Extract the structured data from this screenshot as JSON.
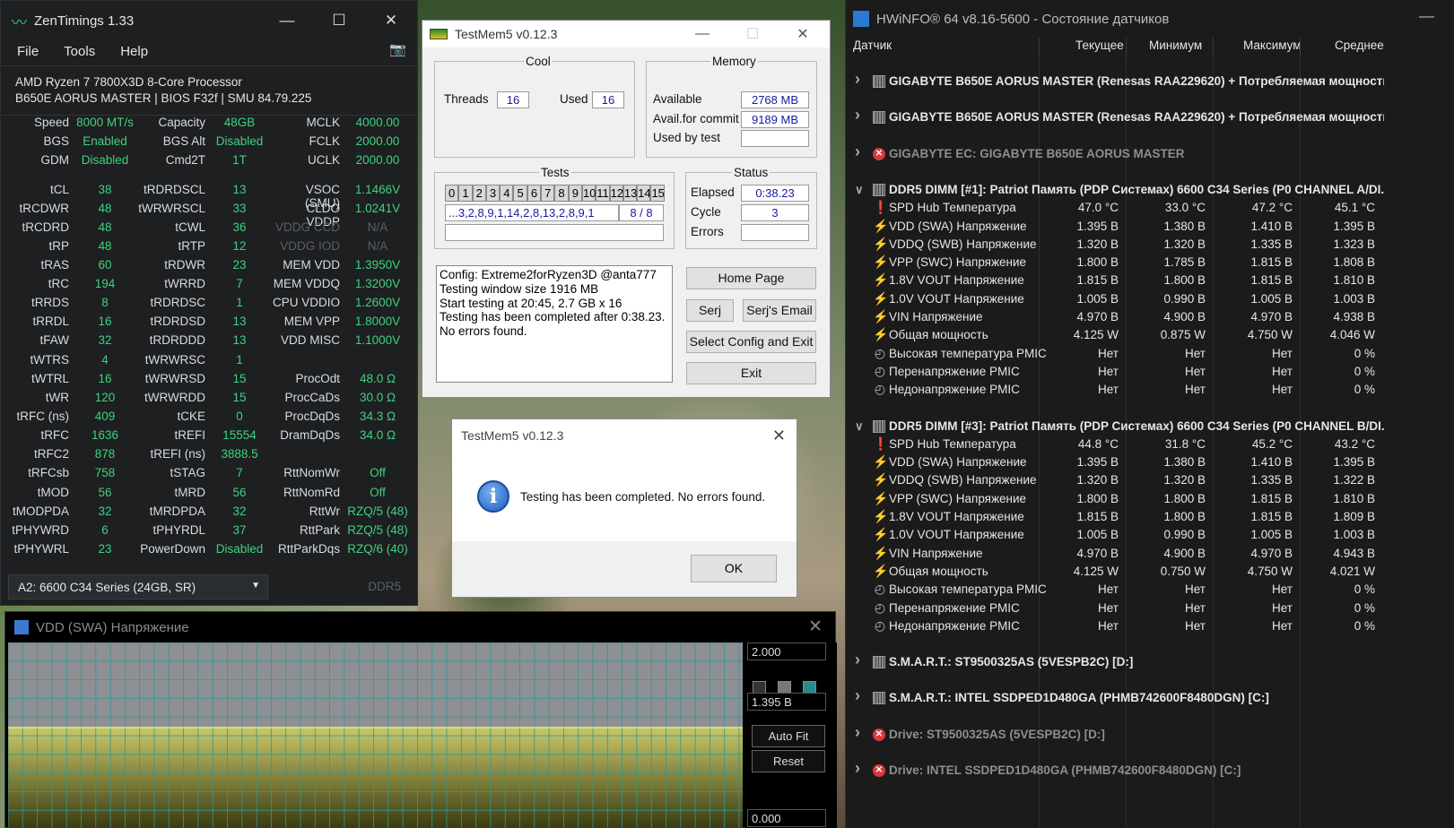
{
  "zentimings": {
    "title": "ZenTimings 1.33",
    "menu": [
      "File",
      "Tools",
      "Help"
    ],
    "cpu": "AMD Ryzen 7 7800X3D 8-Core Processor",
    "board": "B650E AORUS MASTER | BIOS F32f | SMU 84.79.225",
    "rows": [
      [
        "Speed",
        "8000 MT/s",
        "Capacity",
        "48GB",
        "MCLK",
        "4000.00"
      ],
      [
        "BGS",
        "Enabled",
        "BGS Alt",
        "Disabled",
        "FCLK",
        "2000.00"
      ],
      [
        "GDM",
        "Disabled",
        "Cmd2T",
        "1T",
        "UCLK",
        "2000.00"
      ],
      [
        "tCL",
        "38",
        "tRDRDSCL",
        "13",
        "VSOC (SMU)",
        "1.1466V"
      ],
      [
        "tRCDWR",
        "48",
        "tWRWRSCL",
        "33",
        "CLDO VDDP",
        "1.0241V"
      ],
      [
        "tRCDRD",
        "48",
        "tCWL",
        "36",
        "VDDG CCD",
        "N/A"
      ],
      [
        "tRP",
        "48",
        "tRTP",
        "12",
        "VDDG IOD",
        "N/A"
      ],
      [
        "tRAS",
        "60",
        "tRDWR",
        "23",
        "MEM VDD",
        "1.3950V"
      ],
      [
        "tRC",
        "194",
        "tWRRD",
        "7",
        "MEM VDDQ",
        "1.3200V"
      ],
      [
        "tRRDS",
        "8",
        "tRDRDSC",
        "1",
        "CPU VDDIO",
        "1.2600V"
      ],
      [
        "tRRDL",
        "16",
        "tRDRDSD",
        "13",
        "MEM VPP",
        "1.8000V"
      ],
      [
        "tFAW",
        "32",
        "tRDRDDD",
        "13",
        "VDD MISC",
        "1.1000V"
      ],
      [
        "tWTRS",
        "4",
        "tWRWRSC",
        "1",
        "",
        ""
      ],
      [
        "tWTRL",
        "16",
        "tWRWRSD",
        "15",
        "ProcOdt",
        "48.0 Ω"
      ],
      [
        "tWR",
        "120",
        "tWRWRDD",
        "15",
        "ProcCaDs",
        "30.0 Ω"
      ],
      [
        "tRFC (ns)",
        "409",
        "tCKE",
        "0",
        "ProcDqDs",
        "34.3 Ω"
      ],
      [
        "tRFC",
        "1636",
        "tREFI",
        "15554",
        "DramDqDs",
        "34.0 Ω"
      ],
      [
        "tRFC2",
        "878",
        "tREFI (ns)",
        "3888.5",
        "",
        ""
      ],
      [
        "tRFCsb",
        "758",
        "tSTAG",
        "7",
        "RttNomWr",
        "Off"
      ],
      [
        "tMOD",
        "56",
        "tMRD",
        "56",
        "RttNomRd",
        "Off"
      ],
      [
        "tMODPDA",
        "32",
        "tMRDPDA",
        "32",
        "RttWr",
        "RZQ/5 (48)"
      ],
      [
        "tPHYWRD",
        "6",
        "tPHYRDL",
        "37",
        "RttPark",
        "RZQ/5 (48)"
      ],
      [
        "tPHYWRL",
        "23",
        "PowerDown",
        "Disabled",
        "RttParkDqs",
        "RZQ/6 (40)"
      ]
    ],
    "module": "A2: 6600 C34 Series (24GB, SR)",
    "ddr": "DDR5"
  },
  "testmem": {
    "title": "TestMem5 v0.12.3",
    "cool": "Cool",
    "threads_label": "Threads",
    "threads": "16",
    "used_label": "Used",
    "used": "16",
    "memory": "Memory",
    "available_label": "Available",
    "available": "2768 MB",
    "commit_label": "Avail.for commit",
    "commit": "9189 MB",
    "usedby_label": "Used by test",
    "usedby": "",
    "tests": "Tests",
    "cells": [
      "0",
      "1",
      "2",
      "3",
      "4",
      "5",
      "6",
      "7",
      "8",
      "9",
      "10",
      "11",
      "12",
      "13",
      "14",
      "15"
    ],
    "sequence": "...3,2,8,9,1,14,2,8,13,2,8,9,1",
    "progress": "8 / 8",
    "status": "Status",
    "elapsed_label": "Elapsed",
    "elapsed": "0:38.23",
    "cycle_label": "Cycle",
    "cycle": "3",
    "errors_label": "Errors",
    "errors": "",
    "log": [
      "Config: Extreme2forRyzen3D @anta777",
      "Testing window size 1916 MB",
      "Start testing at 20:45, 2.7 GB x 16",
      "Testing has been completed after 0:38.23.",
      "No errors found."
    ],
    "home": "Home Page",
    "serj": "Serj",
    "email": "Serj's Email",
    "select": "Select Config and Exit",
    "exit": "Exit"
  },
  "dialog": {
    "title": "TestMem5 v0.12.3",
    "message": "Testing has been completed. No errors found.",
    "ok": "OK"
  },
  "graph": {
    "title": "VDD (SWA) Напряжение",
    "max": "2.000",
    "current": "1.395 В",
    "min": "0.000",
    "autofit": "Auto Fit",
    "reset": "Reset",
    "level": 0.6975
  },
  "hwinfo": {
    "title": "HWiNFO® 64 v8.16-5600 - Состояние датчиков",
    "headers": [
      "Датчик",
      "Текущее",
      "Минимум",
      "Максимум",
      "Среднее"
    ],
    "rows": [
      {
        "t": "g",
        "icon": "chip",
        "name": "GIGABYTE B650E AORUS MASTER (Renesas RAA229620) + Потребляемая мощность ...",
        "open": false
      },
      {
        "t": "b"
      },
      {
        "t": "g",
        "icon": "chip",
        "name": "GIGABYTE B650E AORUS MASTER (Renesas RAA229620) + Потребляемая мощность ...",
        "open": false
      },
      {
        "t": "b"
      },
      {
        "t": "g",
        "icon": "err",
        "name": "GIGABYTE EC: GIGABYTE B650E AORUS MASTER",
        "open": false
      },
      {
        "t": "b"
      },
      {
        "t": "g",
        "icon": "chip",
        "name": "DDR5 DIMM [#1]: Patriot Память (PDP Системах) 6600 C34 Series (P0 CHANNEL A/DI...",
        "open": true
      },
      {
        "t": "s",
        "icon": "temp",
        "name": "SPD Hub Температура",
        "v": [
          "47.0 °C",
          "33.0 °C",
          "47.2 °C",
          "45.1 °C"
        ]
      },
      {
        "t": "s",
        "icon": "volt",
        "name": "VDD (SWA) Напряжение",
        "v": [
          "1.395 В",
          "1.380 В",
          "1.410 В",
          "1.395 В"
        ]
      },
      {
        "t": "s",
        "icon": "volt",
        "name": "VDDQ (SWB) Напряжение",
        "v": [
          "1.320 В",
          "1.320 В",
          "1.335 В",
          "1.323 В"
        ]
      },
      {
        "t": "s",
        "icon": "volt",
        "name": "VPP (SWC) Напряжение",
        "v": [
          "1.800 В",
          "1.785 В",
          "1.815 В",
          "1.808 В"
        ]
      },
      {
        "t": "s",
        "icon": "volt",
        "name": "1.8V VOUT Напряжение",
        "v": [
          "1.815 В",
          "1.800 В",
          "1.815 В",
          "1.810 В"
        ]
      },
      {
        "t": "s",
        "icon": "volt",
        "name": "1.0V VOUT Напряжение",
        "v": [
          "1.005 В",
          "0.990 В",
          "1.005 В",
          "1.003 В"
        ]
      },
      {
        "t": "s",
        "icon": "volt",
        "name": "VIN Напряжение",
        "v": [
          "4.970 В",
          "4.900 В",
          "4.970 В",
          "4.938 В"
        ]
      },
      {
        "t": "s",
        "icon": "volt",
        "name": "Общая мощность",
        "v": [
          "4.125 W",
          "0.875 W",
          "4.750 W",
          "4.046 W"
        ]
      },
      {
        "t": "s",
        "icon": "clock",
        "name": "Высокая температура PMIC",
        "v": [
          "Нет",
          "Нет",
          "Нет",
          "0 %"
        ]
      },
      {
        "t": "s",
        "icon": "clock",
        "name": "Перенапряжение PMIC",
        "v": [
          "Нет",
          "Нет",
          "Нет",
          "0 %"
        ]
      },
      {
        "t": "s",
        "icon": "clock",
        "name": "Недонапряжение PMIC",
        "v": [
          "Нет",
          "Нет",
          "Нет",
          "0 %"
        ]
      },
      {
        "t": "b"
      },
      {
        "t": "g",
        "icon": "chip",
        "name": "DDR5 DIMM [#3]: Patriot Память (PDP Системах) 6600 C34 Series (P0 CHANNEL B/DI...",
        "open": true
      },
      {
        "t": "s",
        "icon": "temp",
        "name": "SPD Hub Температура",
        "v": [
          "44.8 °C",
          "31.8 °C",
          "45.2 °C",
          "43.2 °C"
        ]
      },
      {
        "t": "s",
        "icon": "volt",
        "name": "VDD (SWA) Напряжение",
        "v": [
          "1.395 В",
          "1.380 В",
          "1.410 В",
          "1.395 В"
        ]
      },
      {
        "t": "s",
        "icon": "volt",
        "name": "VDDQ (SWB) Напряжение",
        "v": [
          "1.320 В",
          "1.320 В",
          "1.335 В",
          "1.322 В"
        ]
      },
      {
        "t": "s",
        "icon": "volt",
        "name": "VPP (SWC) Напряжение",
        "v": [
          "1.800 В",
          "1.800 В",
          "1.815 В",
          "1.810 В"
        ]
      },
      {
        "t": "s",
        "icon": "volt",
        "name": "1.8V VOUT Напряжение",
        "v": [
          "1.815 В",
          "1.800 В",
          "1.815 В",
          "1.809 В"
        ]
      },
      {
        "t": "s",
        "icon": "volt",
        "name": "1.0V VOUT Напряжение",
        "v": [
          "1.005 В",
          "0.990 В",
          "1.005 В",
          "1.003 В"
        ]
      },
      {
        "t": "s",
        "icon": "volt",
        "name": "VIN Напряжение",
        "v": [
          "4.970 В",
          "4.900 В",
          "4.970 В",
          "4.943 В"
        ]
      },
      {
        "t": "s",
        "icon": "volt",
        "name": "Общая мощность",
        "v": [
          "4.125 W",
          "0.750 W",
          "4.750 W",
          "4.021 W"
        ]
      },
      {
        "t": "s",
        "icon": "clock",
        "name": "Высокая температура PMIC",
        "v": [
          "Нет",
          "Нет",
          "Нет",
          "0 %"
        ]
      },
      {
        "t": "s",
        "icon": "clock",
        "name": "Перенапряжение PMIC",
        "v": [
          "Нет",
          "Нет",
          "Нет",
          "0 %"
        ]
      },
      {
        "t": "s",
        "icon": "clock",
        "name": "Недонапряжение PMIC",
        "v": [
          "Нет",
          "Нет",
          "Нет",
          "0 %"
        ]
      },
      {
        "t": "b"
      },
      {
        "t": "g",
        "icon": "chip",
        "name": "S.M.A.R.T.: ST9500325AS (5VESPB2C) [D:]",
        "open": false
      },
      {
        "t": "b"
      },
      {
        "t": "g",
        "icon": "chip",
        "name": "S.M.A.R.T.: INTEL SSDPED1D480GA (PHMB742600F8480DGN) [C:]",
        "open": false
      },
      {
        "t": "b"
      },
      {
        "t": "g",
        "icon": "err",
        "name": "Drive: ST9500325AS (5VESPB2C) [D:]",
        "open": false
      },
      {
        "t": "b"
      },
      {
        "t": "g",
        "icon": "err",
        "name": "Drive: INTEL SSDPED1D480GA (PHMB742600F8480DGN) [C:]",
        "open": false
      }
    ]
  }
}
